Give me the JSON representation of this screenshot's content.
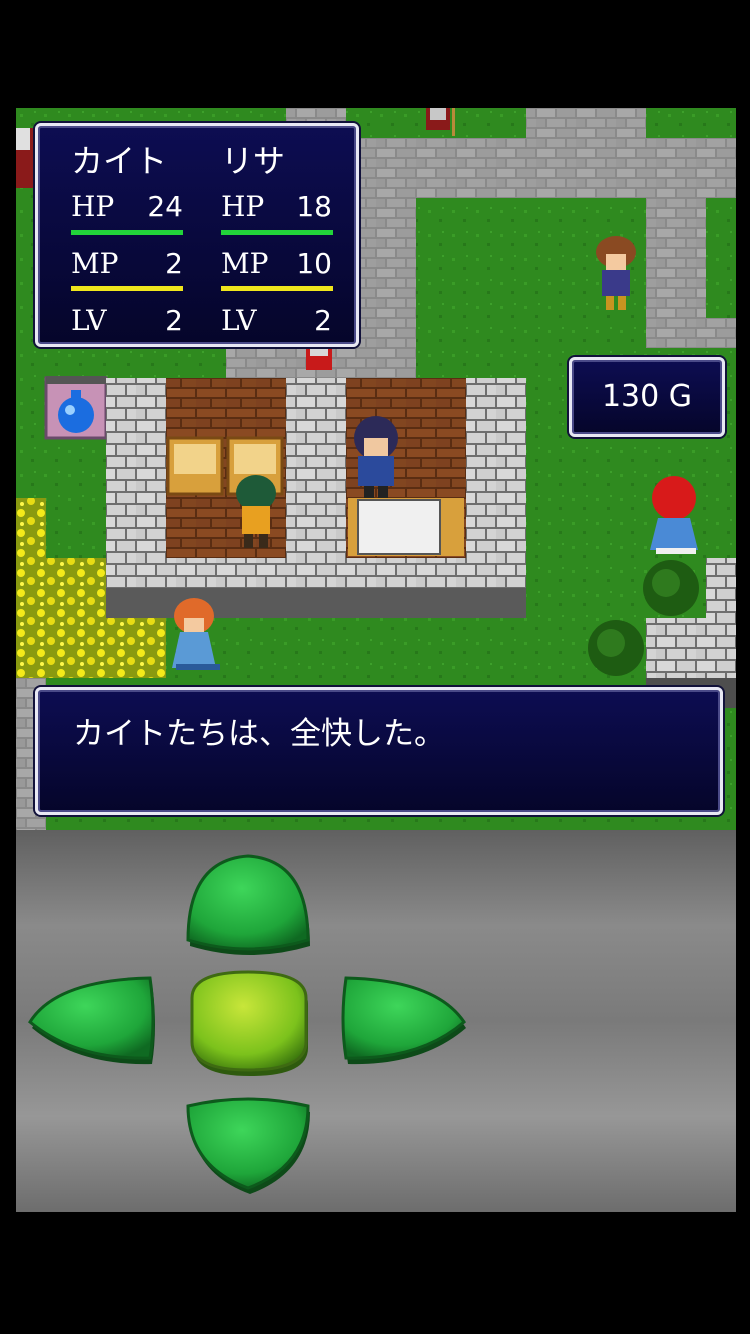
{
  "party": [
    {
      "name": "カイト",
      "hp_label": "HP",
      "hp": "24",
      "mp_label": "MP",
      "mp": "2",
      "lv_label": "LV",
      "lv": "2"
    },
    {
      "name": "リサ",
      "hp_label": "HP",
      "hp": "18",
      "mp_label": "MP",
      "mp": "10",
      "lv_label": "LV",
      "lv": "2"
    }
  ],
  "gold": "130 G",
  "message": "カイトたちは、全快した。",
  "colors": {
    "hp_bar": "#22d43a",
    "mp_bar": "#f0e61c",
    "window_bg": "#0a0a40"
  },
  "dpad": {
    "up_icon": "arrow-up",
    "down_icon": "arrow-down",
    "left_icon": "arrow-left",
    "right_icon": "arrow-right",
    "center_icon": "confirm"
  }
}
